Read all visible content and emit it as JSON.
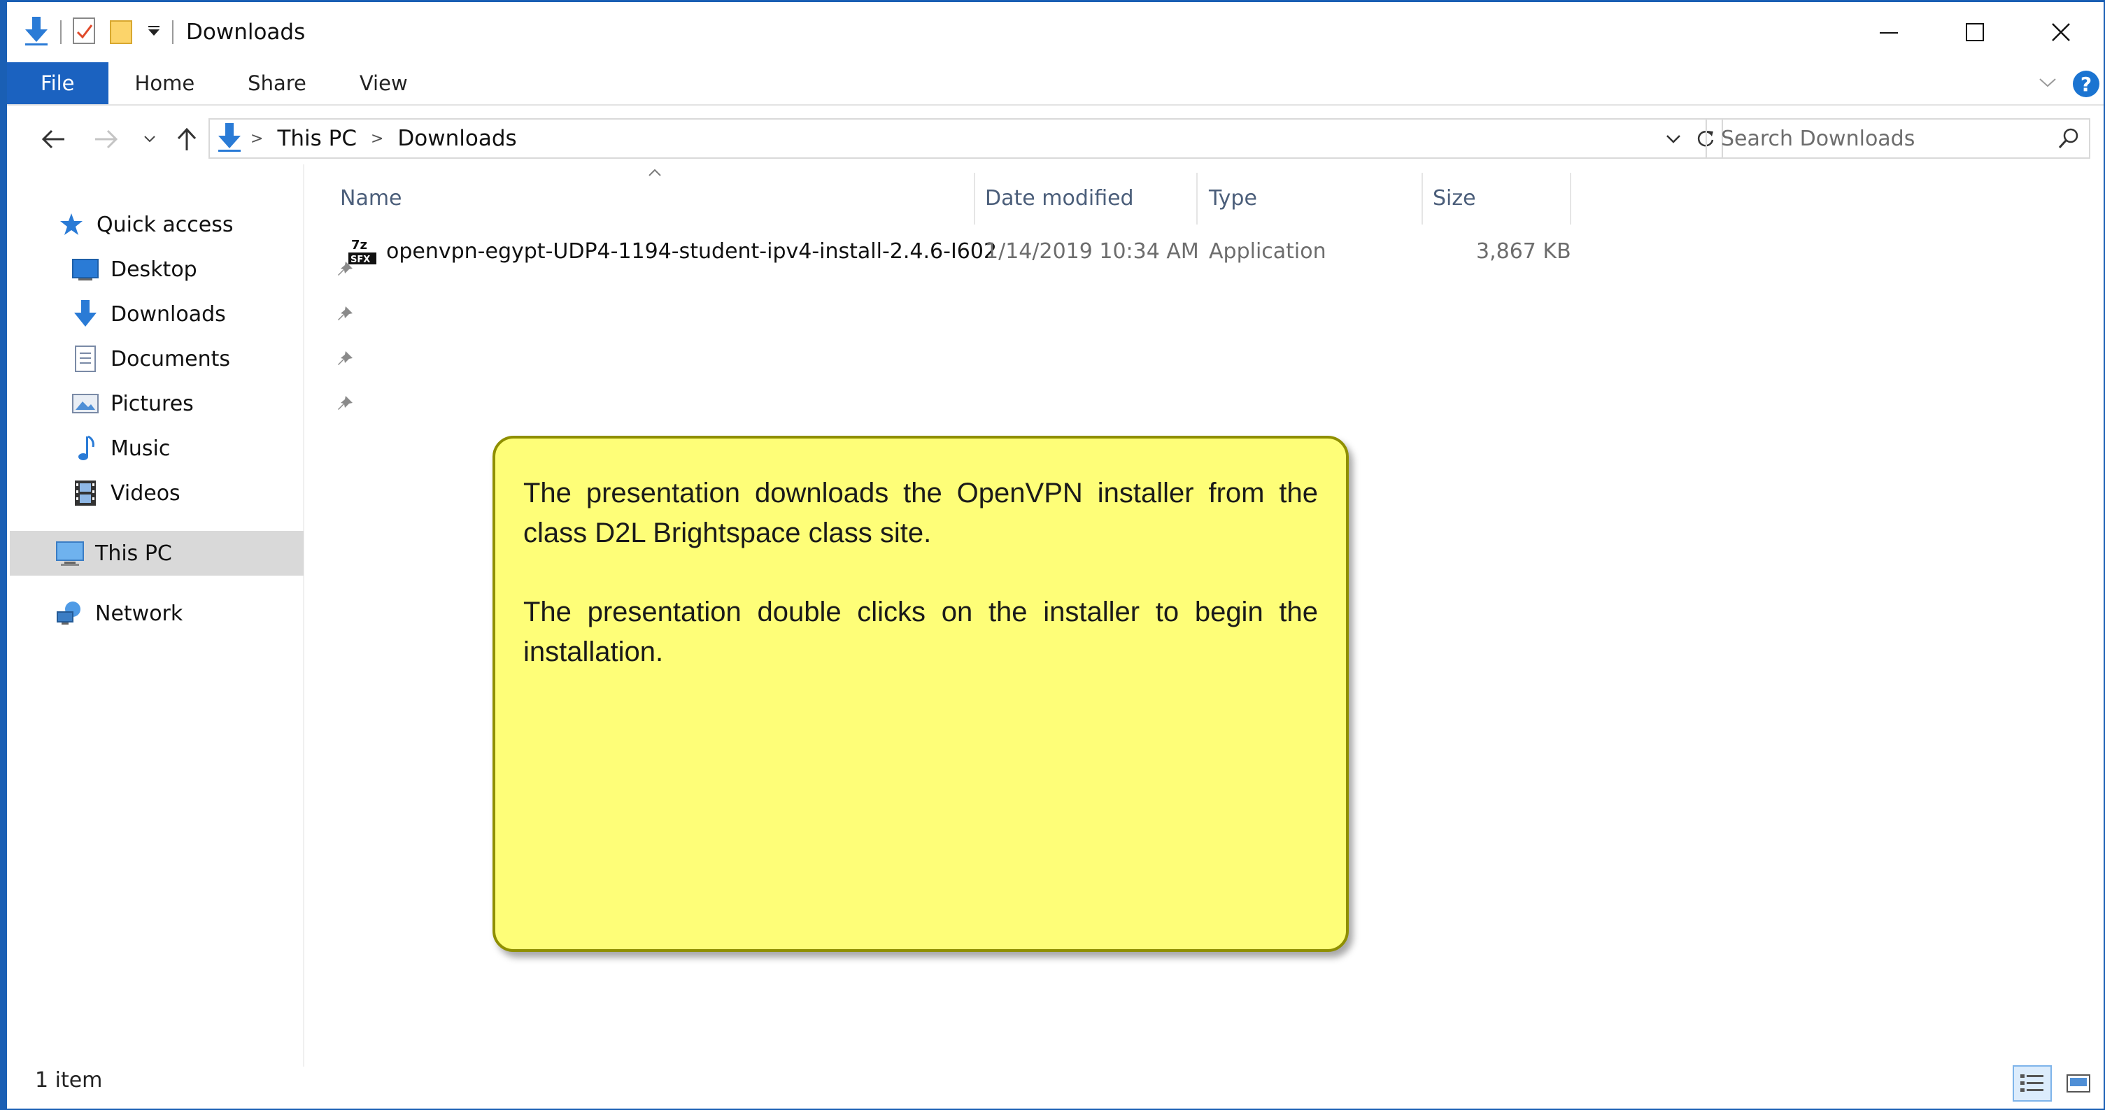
{
  "window": {
    "title": "Downloads"
  },
  "ribbon": {
    "tabs": [
      "File",
      "Home",
      "Share",
      "View"
    ]
  },
  "address": {
    "crumbs": [
      "This PC",
      "Downloads"
    ]
  },
  "search": {
    "placeholder": "Search Downloads"
  },
  "sidebar": {
    "quick_access": "Quick access",
    "items": [
      "Desktop",
      "Downloads",
      "Documents",
      "Pictures",
      "Music",
      "Videos"
    ],
    "this_pc": "This PC",
    "network": "Network"
  },
  "columns": {
    "name": "Name",
    "date": "Date modified",
    "type": "Type",
    "size": "Size"
  },
  "files": [
    {
      "name": "openvpn-egypt-UDP4-1194-student-ipv4-install-2.4.6-I602",
      "date": "1/14/2019 10:34 AM",
      "type": "Application",
      "size": "3,867 KB",
      "icon": "7z-sfx-icon"
    }
  ],
  "callout": {
    "paragraph1": "The presentation downloads the OpenVPN installer from the class D2L Brightspace class site.",
    "paragraph2": "The presentation double clicks on the installer to begin the installation."
  },
  "status": {
    "item_count": "1 item"
  },
  "colors": {
    "accent": "#1b62c0",
    "callout_fill": "#fefe78",
    "selection": "#d9d9d9"
  }
}
